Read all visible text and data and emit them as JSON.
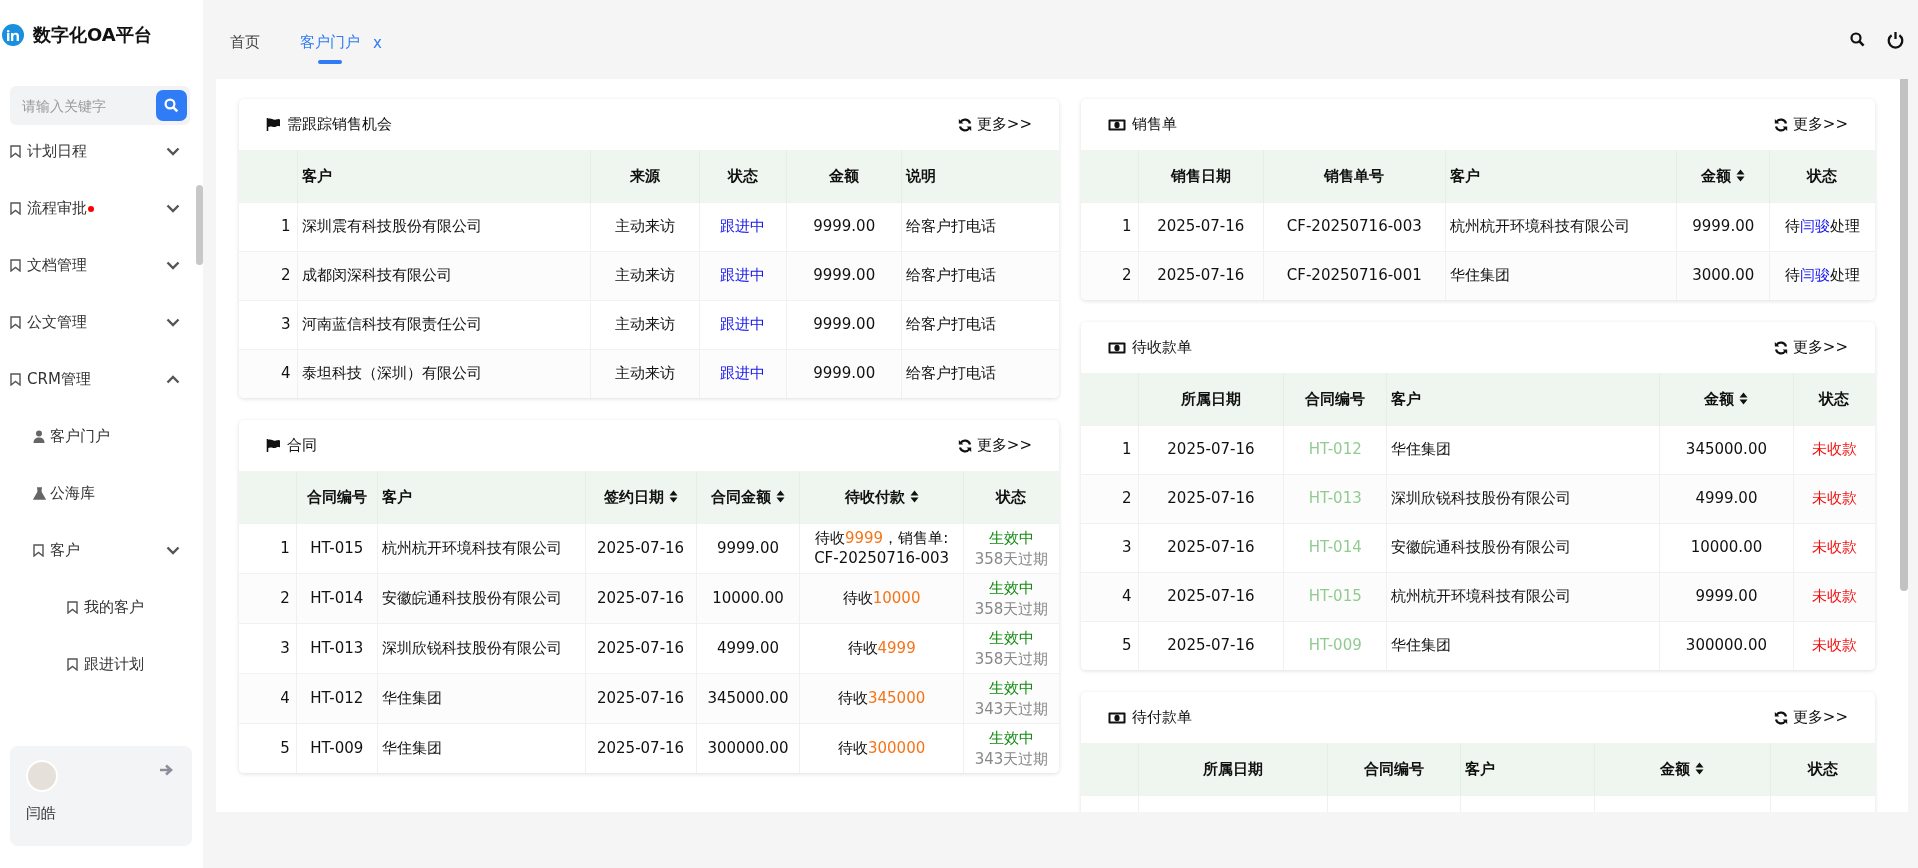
{
  "app": {
    "title": "数字化OA平台"
  },
  "search": {
    "placeholder": "请输入关键字"
  },
  "menu": [
    {
      "label": "计划日程",
      "kind": "menu",
      "expanded": false,
      "badge": false
    },
    {
      "label": "流程审批",
      "kind": "menu",
      "expanded": false,
      "badge": true
    },
    {
      "label": "文档管理",
      "kind": "menu",
      "expanded": false,
      "badge": false
    },
    {
      "label": "公文管理",
      "kind": "menu",
      "expanded": false,
      "badge": false
    },
    {
      "label": "CRM管理",
      "kind": "menu",
      "expanded": true,
      "badge": false,
      "children": [
        {
          "label": "客户门户",
          "kind": "portal"
        },
        {
          "label": "公海库",
          "kind": "pool"
        },
        {
          "label": "客户",
          "kind": "menu",
          "expanded": false,
          "children": [
            {
              "label": "我的客户",
              "kind": "menu"
            },
            {
              "label": "跟进计划",
              "kind": "menu"
            }
          ]
        }
      ]
    }
  ],
  "user": {
    "name": "闫皓"
  },
  "tabs": [
    {
      "label": "首页",
      "selected": false
    },
    {
      "label": "客户门户",
      "selected": true,
      "close": "x"
    }
  ],
  "columns": [
    {
      "cards": [
        {
          "title": "需跟踪销售机会",
          "kind": "flag",
          "more": "更多>>",
          "columns": [
            {
              "sortable": false
            },
            {
              "label": "客户",
              "sortable": false
            },
            {
              "label": "来源",
              "sortable": false
            },
            {
              "label": "状态",
              "sortable": false
            },
            {
              "label": "金额",
              "sortable": false
            },
            {
              "label": "说明",
              "sortable": false
            }
          ],
          "rows": [
            [
              "1",
              "深圳震有科技股份有限公司",
              "主动来访",
              {
                "kind": "follow",
                "text": "跟进中"
              },
              "9999.00",
              "给客户打电话"
            ],
            [
              "2",
              "成都闵深科技有限公司",
              "主动来访",
              {
                "kind": "follow",
                "text": "跟进中"
              },
              "9999.00",
              "给客户打电话"
            ],
            [
              "3",
              "河南蓝信科技有限责任公司",
              "主动来访",
              {
                "kind": "follow",
                "text": "跟进中"
              },
              "9999.00",
              "给客户打电话"
            ],
            [
              "4",
              "泰坦科技（深圳）有限公司",
              "主动来访",
              {
                "kind": "follow",
                "text": "跟进中"
              },
              "9999.00",
              "给客户打电话"
            ]
          ]
        },
        {
          "title": "合同",
          "kind": "flag",
          "more": "更多>>",
          "columns": [
            {
              "sortable": false
            },
            {
              "label": "合同编号",
              "sortable": false
            },
            {
              "label": "客户",
              "sortable": false
            },
            {
              "label": "签约日期",
              "sortable": true
            },
            {
              "label": "合同金额",
              "sortable": true
            },
            {
              "label": "待收付款",
              "sortable": true
            },
            {
              "label": "状态",
              "sortable": false
            }
          ],
          "rows": [
            [
              "1",
              "HT-015",
              "杭州杭开环境科技有限公司",
              "2025-07-16",
              "9999.00",
              {
                "kind": "due",
                "before": "待收",
                "amount": "9999",
                "after": "，销售单: CF-20250716-003"
              },
              {
                "kind": "valid",
                "text": "生效中",
                "note": "358天过期"
              }
            ],
            [
              "2",
              "HT-014",
              "安徽皖通科技股份有限公司",
              "2025-07-16",
              "10000.00",
              {
                "kind": "due",
                "before": "待收",
                "amount": "10000"
              },
              {
                "kind": "valid",
                "text": "生效中",
                "note": "358天过期"
              }
            ],
            [
              "3",
              "HT-013",
              "深圳欣锐科技股份有限公司",
              "2025-07-16",
              "4999.00",
              {
                "kind": "due",
                "before": "待收",
                "amount": "4999"
              },
              {
                "kind": "valid",
                "text": "生效中",
                "note": "358天过期"
              }
            ],
            [
              "4",
              "HT-012",
              "华住集团",
              "2025-07-16",
              "345000.00",
              {
                "kind": "due",
                "before": "待收",
                "amount": "345000"
              },
              {
                "kind": "valid",
                "text": "生效中",
                "note": "343天过期"
              }
            ],
            [
              "5",
              "HT-009",
              "华住集团",
              "2025-07-16",
              "300000.00",
              {
                "kind": "due",
                "before": "待收",
                "amount": "300000"
              },
              {
                "kind": "valid",
                "text": "生效中",
                "note": "343天过期"
              }
            ]
          ]
        }
      ]
    },
    {
      "cards": [
        {
          "title": "销售单",
          "kind": "money",
          "more": "更多>>",
          "columns": [
            {
              "sortable": false
            },
            {
              "label": "销售日期",
              "sortable": false
            },
            {
              "label": "销售单号",
              "sortable": false
            },
            {
              "label": "客户",
              "sortable": false
            },
            {
              "label": "金额",
              "sortable": true
            },
            {
              "label": "状态",
              "sortable": false
            }
          ],
          "rows": [
            [
              "1",
              "2025-07-16",
              "CF-20250716-003",
              "杭州杭开环境科技有限公司",
              "9999.00",
              {
                "kind": "handler",
                "before": "待",
                "name": "闫骏",
                "after": "处理"
              }
            ],
            [
              "2",
              "2025-07-16",
              "CF-20250716-001",
              "华住集团",
              "3000.00",
              {
                "kind": "handler",
                "before": "待",
                "name": "闫骏",
                "after": "处理"
              }
            ]
          ]
        },
        {
          "title": "待收款单",
          "kind": "money",
          "more": "更多>>",
          "columns": [
            {
              "sortable": false
            },
            {
              "label": "所属日期",
              "sortable": false
            },
            {
              "label": "合同编号",
              "sortable": false
            },
            {
              "label": "客户",
              "sortable": false
            },
            {
              "label": "金额",
              "sortable": true
            },
            {
              "label": "状态",
              "sortable": false
            }
          ],
          "rows": [
            [
              "1",
              "2025-07-16",
              {
                "kind": "contract",
                "text": "HT-012"
              },
              "华住集团",
              "345000.00",
              {
                "kind": "unpaid",
                "text": "未收款"
              }
            ],
            [
              "2",
              "2025-07-16",
              {
                "kind": "contract",
                "text": "HT-013"
              },
              "深圳欣锐科技股份有限公司",
              "4999.00",
              {
                "kind": "unpaid",
                "text": "未收款"
              }
            ],
            [
              "3",
              "2025-07-16",
              {
                "kind": "contract",
                "text": "HT-014"
              },
              "安徽皖通科技股份有限公司",
              "10000.00",
              {
                "kind": "unpaid",
                "text": "未收款"
              }
            ],
            [
              "4",
              "2025-07-16",
              {
                "kind": "contract",
                "text": "HT-015"
              },
              "杭州杭开环境科技有限公司",
              "9999.00",
              {
                "kind": "unpaid",
                "text": "未收款"
              }
            ],
            [
              "5",
              "2025-07-16",
              {
                "kind": "contract",
                "text": "HT-009"
              },
              "华住集团",
              "300000.00",
              {
                "kind": "unpaid",
                "text": "未收款"
              }
            ]
          ]
        },
        {
          "title": "待付款单",
          "kind": "money",
          "more": "更多>>",
          "columns": [
            {
              "sortable": false
            },
            {
              "label": "所属日期",
              "sortable": false
            },
            {
              "label": "合同编号",
              "sortable": false
            },
            {
              "label": "客户",
              "sortable": false
            },
            {
              "label": "金额",
              "sortable": true
            },
            {
              "label": "状态",
              "sortable": false
            }
          ]
        }
      ]
    }
  ]
}
